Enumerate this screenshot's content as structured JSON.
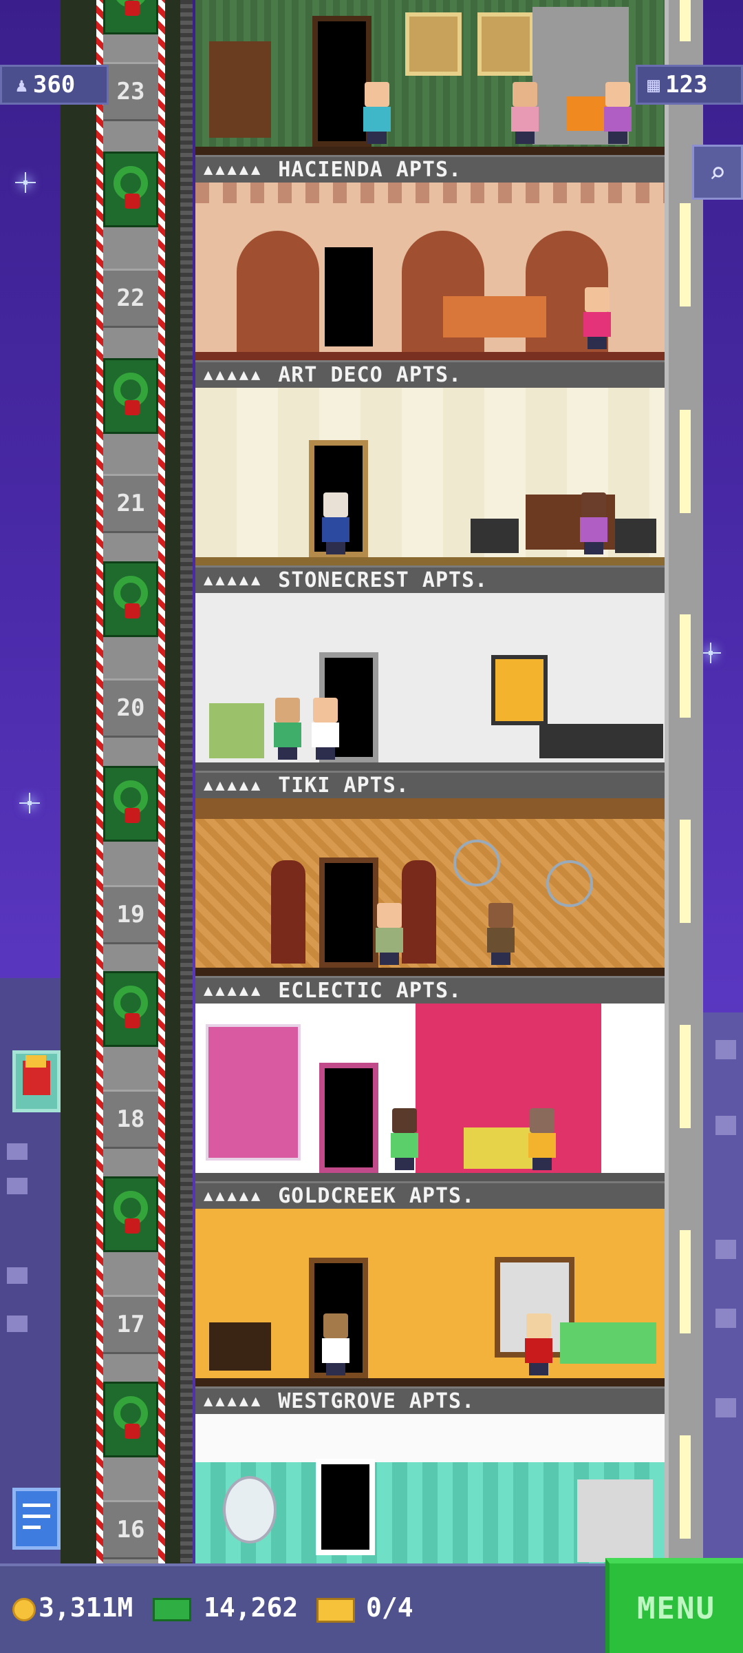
{
  "hud": {
    "population": "360",
    "floor_count": "123"
  },
  "floors": [
    {
      "number": "23",
      "name": "HACIENDA APTS.",
      "rating": "▲▲▲▲▲"
    },
    {
      "number": "22",
      "name": "ART DECO APTS.",
      "rating": "▲▲▲▲▲"
    },
    {
      "number": "21",
      "name": "STONECREST APTS.",
      "rating": "▲▲▲▲▲"
    },
    {
      "number": "20",
      "name": "TIKI APTS.",
      "rating": "▲▲▲▲▲"
    },
    {
      "number": "19",
      "name": "ECLECTIC APTS.",
      "rating": "▲▲▲▲▲"
    },
    {
      "number": "18",
      "name": "GOLDCREEK APTS.",
      "rating": "▲▲▲▲▲"
    },
    {
      "number": "17",
      "name": "WESTGROVE APTS.",
      "rating": "▲▲▲▲▲"
    },
    {
      "number": "16"
    }
  ],
  "bottom": {
    "coins": "3,311M",
    "bux": "14,262",
    "tickets": "0/4",
    "menu_label": "MENU"
  },
  "colors": {
    "hacienda_wall": "#3f6b3f",
    "artdeco_wall": "#e8bfa0",
    "stonecrest_wall": "#efe9cf",
    "tiki_wall": "#ececec",
    "eclectic_wall": "#c98a3e",
    "goldcreek_wall": "#ffffff",
    "westgrove_wall": "#f2b23c",
    "floor16_wall": "#6fe0c5"
  },
  "icons": [
    "population-icon",
    "floor-grid-icon",
    "search-icon",
    "coin-icon",
    "bux-icon",
    "ticket-icon",
    "fries-ad-icon",
    "mail-icon",
    "wreath-icon"
  ]
}
